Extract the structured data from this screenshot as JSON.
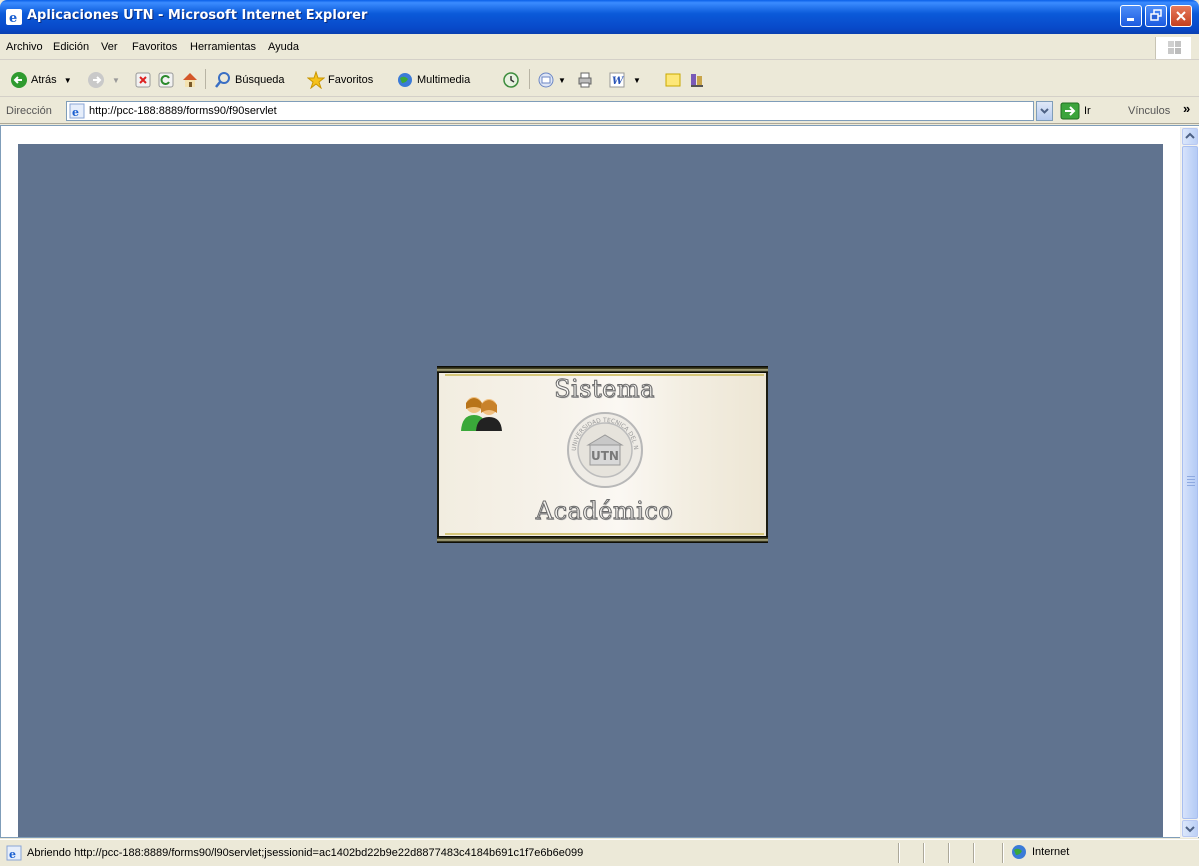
{
  "window": {
    "title": "Aplicaciones UTN - Microsoft Internet Explorer",
    "title_bar_color": "#0a5fe8"
  },
  "menubar": {
    "items": [
      "Archivo",
      "Edición",
      "Ver",
      "Favoritos",
      "Herramientas",
      "Ayuda"
    ]
  },
  "toolbar": {
    "back_label": "Atrás",
    "search_label": "Búsqueda",
    "favorites_label": "Favoritos",
    "media_label": "Multimedia"
  },
  "addressbar": {
    "label": "Dirección",
    "url": "http://pcc-188:8889/forms90/f90servlet",
    "go_label": "Ir",
    "links_label": "Vínculos"
  },
  "content": {
    "applet_background": "#60738f",
    "splash": {
      "word_top": "Sistema",
      "word_bottom": "Académico",
      "seal_text": "UNIVERSIDAD TECNICA DEL NORTE",
      "seal_letters": "UTN",
      "icons": [
        "users-icon",
        "university-seal-icon"
      ]
    }
  },
  "statusbar": {
    "text": "Abriendo http://pcc-188:8889/forms90/l90servlet;jsessionid=ac1402bd22b9e22d8877483c4184b691c1f7e6b6e099",
    "zone": "Internet"
  }
}
